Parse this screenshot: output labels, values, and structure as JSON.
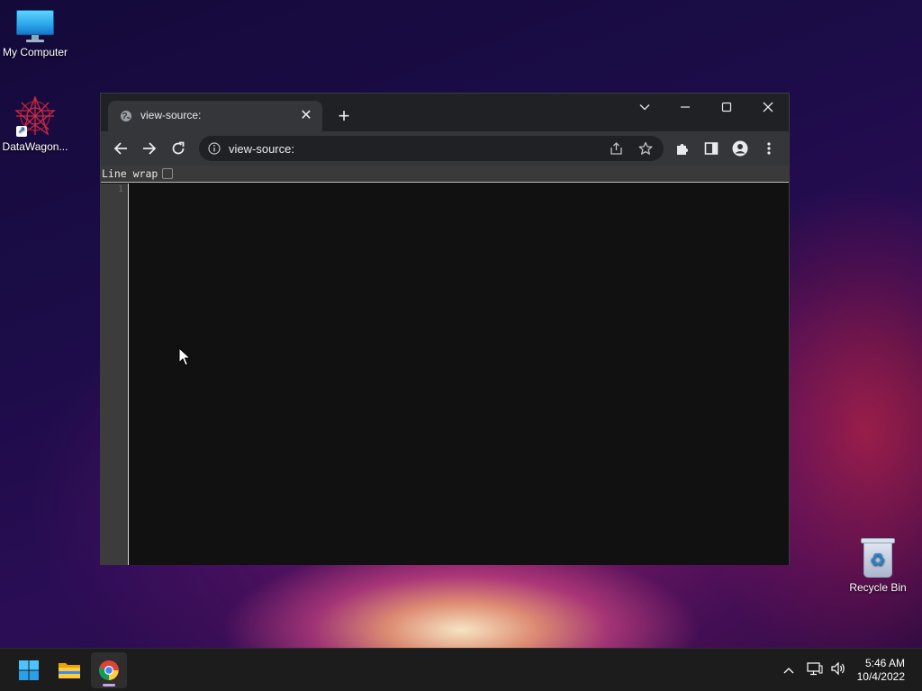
{
  "desktop": {
    "icons": [
      {
        "label": "My Computer",
        "icon": "monitor-icon"
      },
      {
        "label": "DataWagon...",
        "icon": "datawagon-icon"
      },
      {
        "label": "Recycle Bin",
        "icon": "recycle-bin-icon"
      }
    ]
  },
  "browser": {
    "tab": {
      "title": "view-source:",
      "favicon": "globe-icon"
    },
    "omnibox": {
      "url": "view-source:"
    },
    "source_view": {
      "line_wrap_label": "Line wrap",
      "line_wrap_checked": false,
      "line_numbers": [
        "1"
      ]
    },
    "colors": {
      "frame": "#202124",
      "toolbar": "#35363a",
      "content": "#111111"
    }
  },
  "taskbar": {
    "apps": [
      {
        "name": "Start",
        "icon": "windows-start-icon"
      },
      {
        "name": "File Explorer",
        "icon": "folder-icon"
      },
      {
        "name": "Google Chrome",
        "icon": "chrome-icon",
        "active": true
      }
    ],
    "clock": {
      "time": "5:46 AM",
      "date": "10/4/2022"
    }
  }
}
